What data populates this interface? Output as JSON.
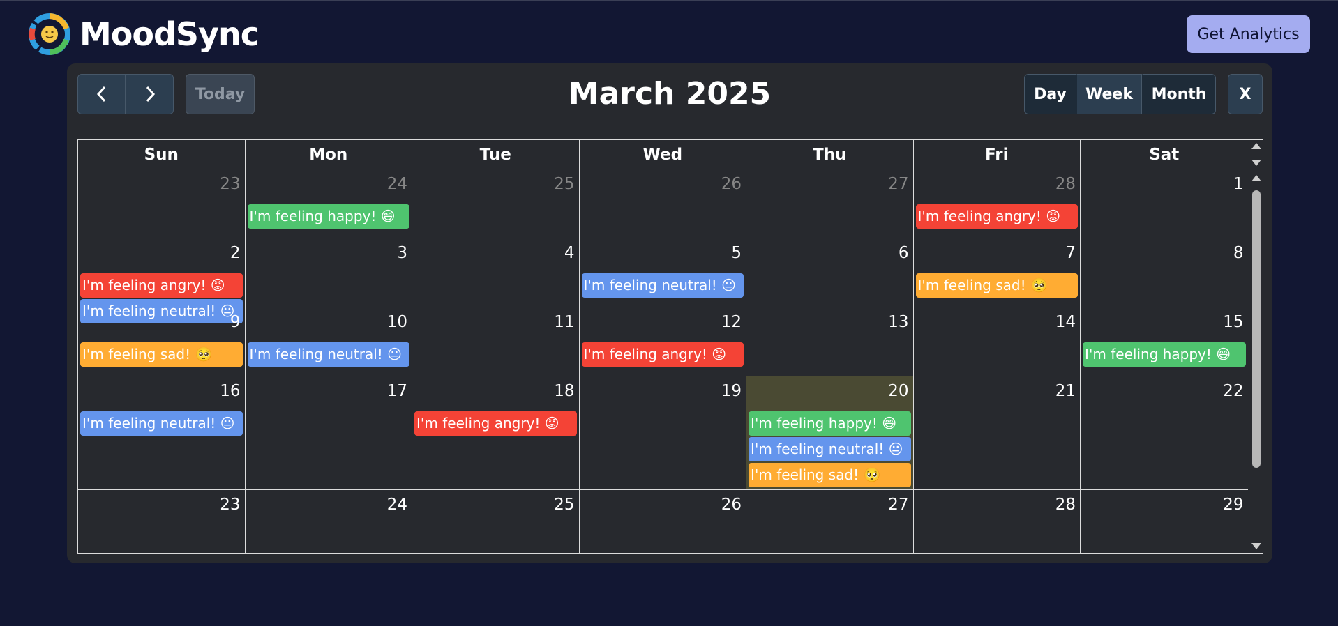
{
  "app": {
    "name": "MoodSync",
    "analytics_label": "Get Analytics"
  },
  "toolbar": {
    "prev_icon": "chevron-left-icon",
    "next_icon": "chevron-right-icon",
    "today_label": "Today",
    "title": "March 2025",
    "views": [
      "Day",
      "Week",
      "Month"
    ],
    "close_label": "X"
  },
  "weekdays": [
    "Sun",
    "Mon",
    "Tue",
    "Wed",
    "Thu",
    "Fri",
    "Sat"
  ],
  "colors": {
    "happy": "#4fc46f",
    "angry": "#f44336",
    "neutral": "#6495ed",
    "sad": "#ffac33",
    "today_highlight": "#4a4a33"
  },
  "weeks": [
    {
      "days": [
        {
          "num": "23",
          "other": true,
          "events": []
        },
        {
          "num": "24",
          "other": true,
          "events": [
            {
              "mood": "happy",
              "label": "I'm feeling happy! 😄"
            }
          ]
        },
        {
          "num": "25",
          "other": true,
          "events": []
        },
        {
          "num": "26",
          "other": true,
          "events": []
        },
        {
          "num": "27",
          "other": true,
          "events": []
        },
        {
          "num": "28",
          "other": true,
          "events": [
            {
              "mood": "angry",
              "label": "I'm feeling angry! 😡"
            }
          ]
        },
        {
          "num": "1",
          "other": false,
          "events": []
        }
      ]
    },
    {
      "days": [
        {
          "num": "2",
          "other": false,
          "events": [
            {
              "mood": "angry",
              "label": "I'm feeling angry! 😡"
            },
            {
              "mood": "neutral",
              "label": "I'm feeling neutral! 😐"
            }
          ]
        },
        {
          "num": "3",
          "other": false,
          "events": []
        },
        {
          "num": "4",
          "other": false,
          "events": []
        },
        {
          "num": "5",
          "other": false,
          "events": [
            {
              "mood": "neutral",
              "label": "I'm feeling neutral! 😐"
            }
          ]
        },
        {
          "num": "6",
          "other": false,
          "events": []
        },
        {
          "num": "7",
          "other": false,
          "events": [
            {
              "mood": "sad",
              "label": "I'm feeling sad! 🥺"
            }
          ]
        },
        {
          "num": "8",
          "other": false,
          "events": []
        }
      ]
    },
    {
      "days": [
        {
          "num": "9",
          "other": false,
          "events": [
            {
              "mood": "sad",
              "label": "I'm feeling sad! 🥺"
            }
          ]
        },
        {
          "num": "10",
          "other": false,
          "events": [
            {
              "mood": "neutral",
              "label": "I'm feeling neutral! 😐"
            }
          ]
        },
        {
          "num": "11",
          "other": false,
          "events": []
        },
        {
          "num": "12",
          "other": false,
          "events": [
            {
              "mood": "angry",
              "label": "I'm feeling angry! 😡"
            }
          ]
        },
        {
          "num": "13",
          "other": false,
          "events": []
        },
        {
          "num": "14",
          "other": false,
          "events": []
        },
        {
          "num": "15",
          "other": false,
          "events": [
            {
              "mood": "happy",
              "label": "I'm feeling happy! 😄"
            }
          ]
        }
      ]
    },
    {
      "days": [
        {
          "num": "16",
          "other": false,
          "events": [
            {
              "mood": "neutral",
              "label": "I'm feeling neutral! 😐"
            }
          ]
        },
        {
          "num": "17",
          "other": false,
          "events": []
        },
        {
          "num": "18",
          "other": false,
          "events": [
            {
              "mood": "angry",
              "label": "I'm feeling angry! 😡"
            }
          ]
        },
        {
          "num": "19",
          "other": false,
          "events": []
        },
        {
          "num": "20",
          "other": false,
          "today": true,
          "events": [
            {
              "mood": "happy",
              "label": "I'm feeling happy! 😄"
            },
            {
              "mood": "neutral",
              "label": "I'm feeling neutral! 😐"
            },
            {
              "mood": "sad",
              "label": "I'm feeling sad! 🥺"
            }
          ]
        },
        {
          "num": "21",
          "other": false,
          "events": []
        },
        {
          "num": "22",
          "other": false,
          "events": []
        }
      ]
    },
    {
      "days": [
        {
          "num": "23",
          "other": false,
          "events": []
        },
        {
          "num": "24",
          "other": false,
          "events": []
        },
        {
          "num": "25",
          "other": false,
          "events": []
        },
        {
          "num": "26",
          "other": false,
          "events": []
        },
        {
          "num": "27",
          "other": false,
          "events": []
        },
        {
          "num": "28",
          "other": false,
          "events": []
        },
        {
          "num": "29",
          "other": false,
          "events": []
        }
      ]
    }
  ]
}
